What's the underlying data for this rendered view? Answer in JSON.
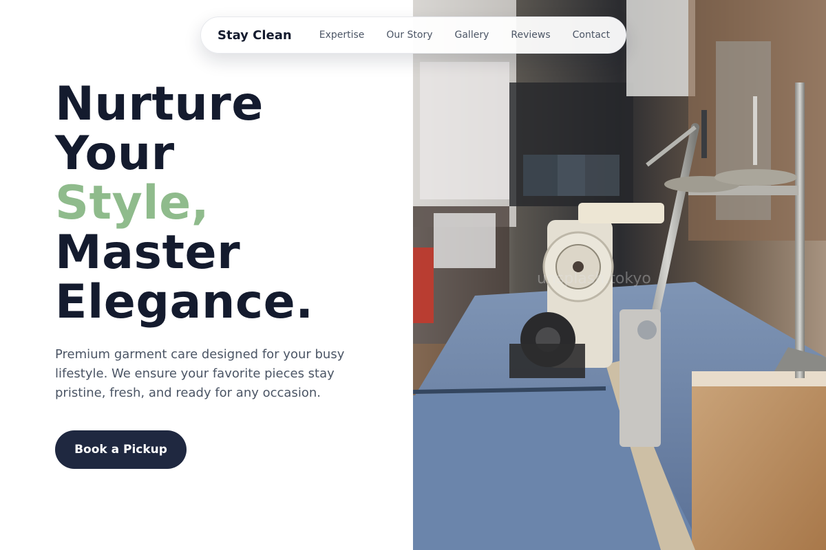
{
  "brand": {
    "name": "Stay Clean"
  },
  "nav": {
    "links": [
      {
        "label": "Expertise"
      },
      {
        "label": "Our Story"
      },
      {
        "label": "Gallery"
      },
      {
        "label": "Reviews"
      },
      {
        "label": "Contact"
      }
    ]
  },
  "hero": {
    "headline": {
      "line1": "Nurture",
      "line2": "Your",
      "line3_accent": "Style,",
      "line4": "Master",
      "line5": "Elegance."
    },
    "subtitle": "Premium garment care designed for your busy lifestyle. We ensure your favorite pieces stay pristine, fresh, and ready for any occasion.",
    "cta_label": "Book a Pickup",
    "image": {
      "icon": "sewing-machine-photo",
      "watermark": "unsplash.tokyo"
    }
  },
  "colors": {
    "text_dark": "#141b2e",
    "accent_green": "#8fbb8c",
    "body_text": "#4b5565",
    "cta_background": "#1f2840",
    "background": "#ffffff"
  }
}
